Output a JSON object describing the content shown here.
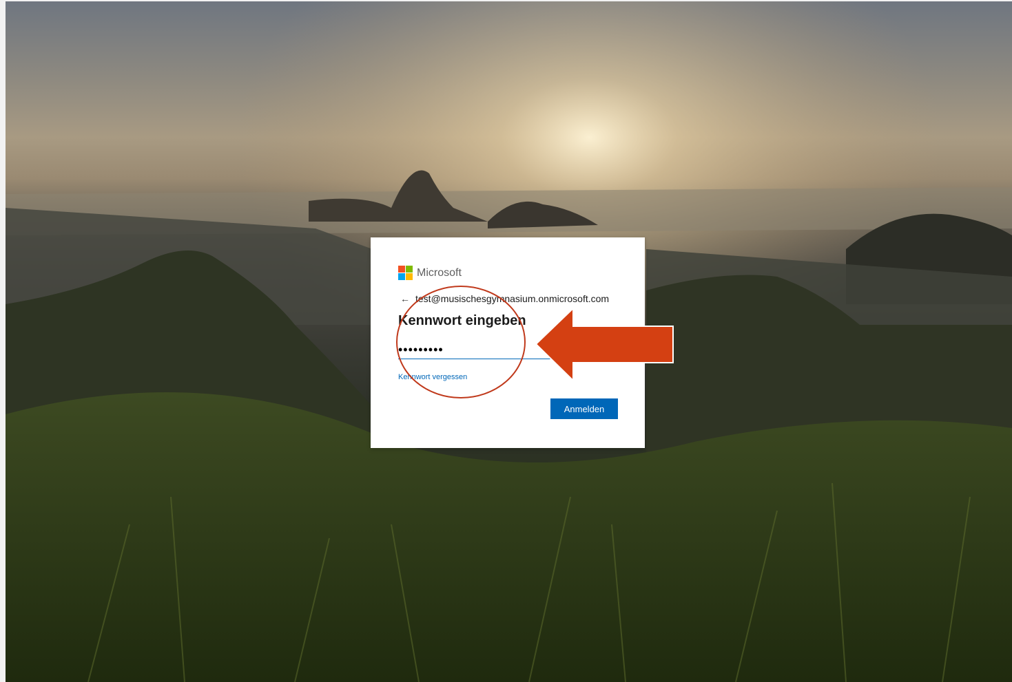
{
  "brand": {
    "name": "Microsoft",
    "logo_colors": [
      "#f25022",
      "#7fba00",
      "#00a4ef",
      "#ffb900"
    ]
  },
  "signin": {
    "identity_email": "test@musischesgymnasium.onmicrosoft.com",
    "back_icon": "arrow-left-icon",
    "title": "Kennwort eingeben",
    "password_value": "•••••••••",
    "forgot_link": "Kennwort vergessen",
    "submit_label": "Anmelden"
  },
  "annotations": {
    "circle_color": "#c0391b",
    "arrow_color": "#d44012"
  },
  "colors": {
    "accent": "#0067b8"
  }
}
